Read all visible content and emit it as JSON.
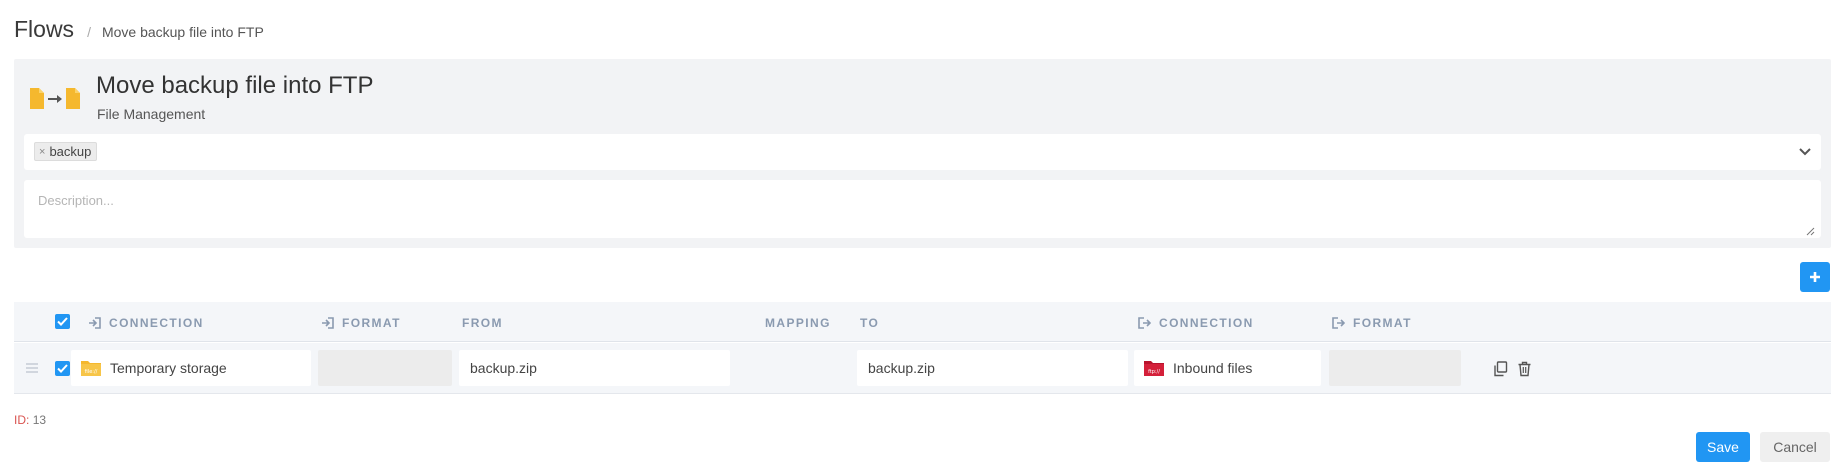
{
  "breadcrumb": {
    "root": "Flows",
    "separator": "/",
    "current": "Move backup file into FTP"
  },
  "flow": {
    "title": "Move backup file into FTP",
    "subtitle": "File Management",
    "icon": "file-transfer-icon"
  },
  "tags": {
    "items": [
      {
        "label": "backup",
        "remove": "×"
      }
    ]
  },
  "description": {
    "value": "",
    "placeholder": "Description..."
  },
  "table": {
    "headers": {
      "source_connection": "CONNECTION",
      "source_format": "FORMAT",
      "from": "FROM",
      "mapping": "MAPPING",
      "to": "TO",
      "target_connection": "CONNECTION",
      "target_format": "FORMAT"
    },
    "rows": [
      {
        "checked": true,
        "source_connection": "Temporary storage",
        "source_connection_icon": "folder-file-icon",
        "source_format": "",
        "from": "backup.zip",
        "to": "backup.zip",
        "target_connection": "Inbound files",
        "target_connection_icon": "folder-ftp-icon",
        "target_format": ""
      }
    ]
  },
  "footer": {
    "id_label": "ID:",
    "id_value": "13",
    "save": "Save",
    "cancel": "Cancel"
  },
  "colors": {
    "primary": "#2196f3",
    "folder_yellow": "#f5b82e",
    "folder_red": "#d4203a",
    "id_label": "#d9534f"
  }
}
